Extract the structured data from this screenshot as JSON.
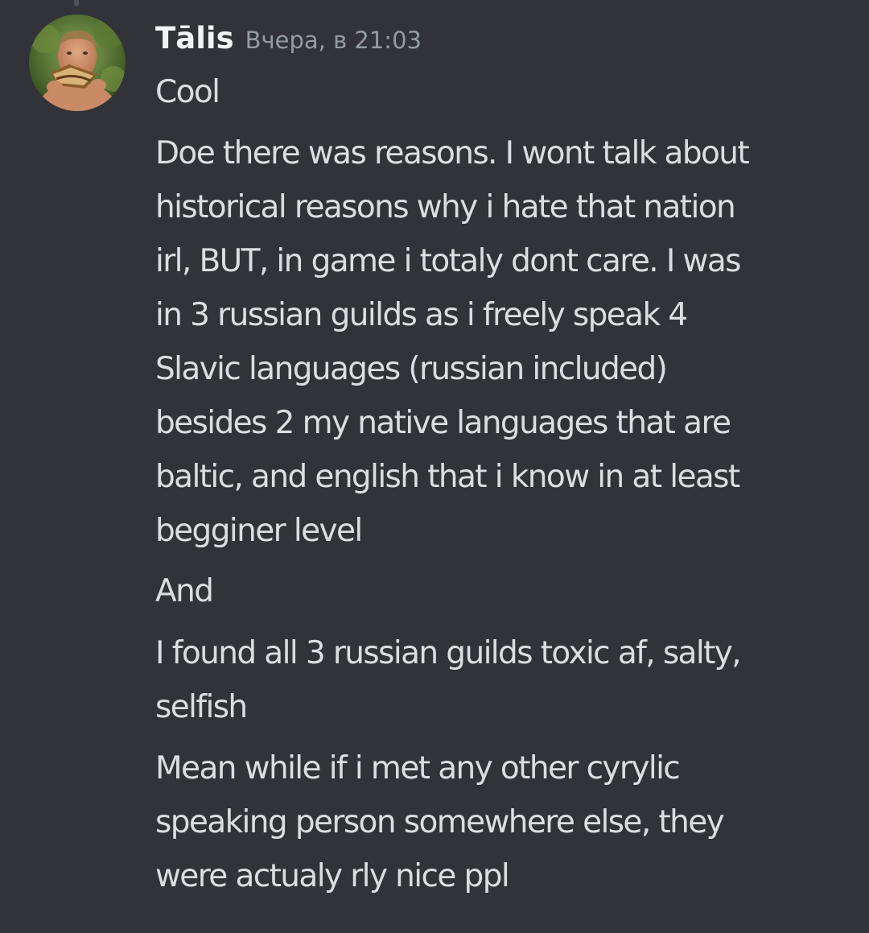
{
  "message": {
    "author": "Tālis",
    "timestamp": "Вчера, в 21:03",
    "lines": [
      "Cool",
      "Doe there was reasons. I wont talk about",
      "historical reasons why i hate that nation",
      "irl, BUT, in game i totaly dont care. I was",
      "in 3 russian guilds as i freely speak 4",
      "Slavic languages (russian included)",
      "besides 2 my native languages that are",
      "baltic, and english that i know in at least",
      "begginer level",
      "And",
      "I found all 3 russian guilds toxic af, salty,",
      "selfish",
      "Mean while if i met any other cyrylic",
      "speaking person somewhere else, they",
      "were actualy rly nice ppl"
    ]
  },
  "colors": {
    "background": "#313338",
    "username": "#f2f3f5",
    "timestamp": "#949ba4",
    "message_text": "#dbdee1"
  }
}
